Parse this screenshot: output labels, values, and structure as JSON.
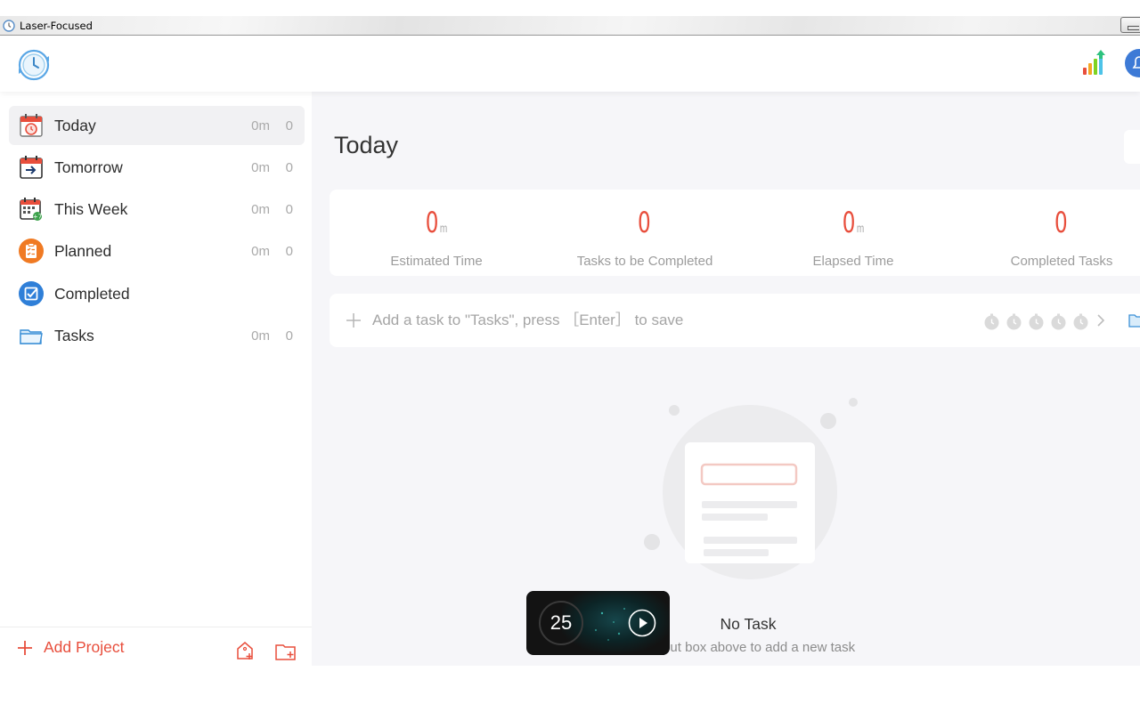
{
  "window": {
    "title": "Laser-Focused"
  },
  "sidebar": {
    "items": [
      {
        "id": "today",
        "label": "Today",
        "time": "0m",
        "count": "0",
        "icon": "calendar-clock-icon"
      },
      {
        "id": "tomorrow",
        "label": "Tomorrow",
        "time": "0m",
        "count": "0",
        "icon": "calendar-arrow-icon"
      },
      {
        "id": "this-week",
        "label": "This Week",
        "time": "0m",
        "count": "0",
        "icon": "calendar-week-icon"
      },
      {
        "id": "planned",
        "label": "Planned",
        "time": "0m",
        "count": "0",
        "icon": "clipboard-icon"
      },
      {
        "id": "completed",
        "label": "Completed",
        "time": "",
        "count": "",
        "icon": "checkbox-icon"
      },
      {
        "id": "tasks",
        "label": "Tasks",
        "time": "0m",
        "count": "0",
        "icon": "folder-icon"
      }
    ],
    "footer": {
      "add_project_label": "Add Project"
    }
  },
  "main": {
    "title": "Today",
    "stats": [
      {
        "value": "0",
        "unit": "m",
        "label": "Estimated Time"
      },
      {
        "value": "0",
        "unit": "",
        "label": "Tasks to be Completed"
      },
      {
        "value": "0",
        "unit": "m",
        "label": "Elapsed Time"
      },
      {
        "value": "0",
        "unit": "",
        "label": "Completed Tasks"
      }
    ],
    "task_input": {
      "placeholder": "Add a task to \"Tasks\", press ［Enter］ to save",
      "value": ""
    },
    "empty": {
      "title": "No Task",
      "hint": "e input box above to add a new task"
    }
  },
  "timer": {
    "value": "25"
  },
  "colors": {
    "accent": "#e84e3c",
    "sidebar_active": "#f1f1f3",
    "main_bg": "#f6f6f9"
  }
}
